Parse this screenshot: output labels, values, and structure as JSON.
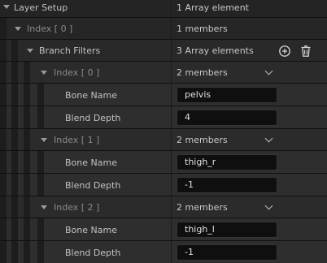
{
  "layer_setup": {
    "label": "Layer Setup",
    "value": "1 Array element"
  },
  "index0": {
    "label": "Index [ 0 ]",
    "value": "1 members"
  },
  "branch_filters": {
    "label": "Branch Filters",
    "value": "3 Array elements"
  },
  "entries": [
    {
      "index_label": "Index [ 0 ]",
      "members": "2 members",
      "bone_name_label": "Bone Name",
      "bone_name": "pelvis",
      "blend_depth_label": "Blend Depth",
      "blend_depth": "4"
    },
    {
      "index_label": "Index [ 1 ]",
      "members": "2 members",
      "bone_name_label": "Bone Name",
      "bone_name": "thigh_r",
      "blend_depth_label": "Blend Depth",
      "blend_depth": "-1"
    },
    {
      "index_label": "Index [ 2 ]",
      "members": "2 members",
      "bone_name_label": "Bone Name",
      "bone_name": "thigh_l",
      "blend_depth_label": "Blend Depth",
      "blend_depth": "-1"
    }
  ],
  "icons": {
    "add": "add-circle-icon",
    "delete": "trash-icon",
    "expand": "caret-down-icon",
    "dropdown": "chevron-down-icon"
  }
}
